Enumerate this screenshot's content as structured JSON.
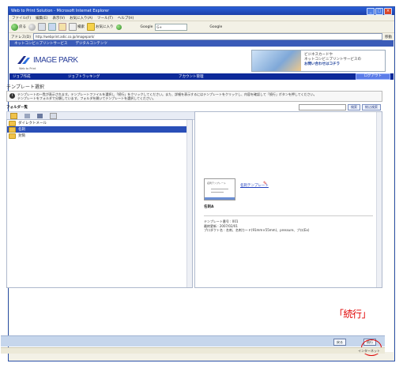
{
  "window": {
    "title": "Web to Print Solution - Microsoft Internet Explorer",
    "controls": [
      "_",
      "□",
      "×"
    ]
  },
  "menu": [
    "ファイル(F)",
    "編集(E)",
    "表示(V)",
    "お気に入り(A)",
    "ツール(T)",
    "ヘルプ(H)"
  ],
  "toolbar": {
    "back": "戻る",
    "search": "検索",
    "favorites": "お気に入り",
    "google": "Google",
    "search_placeholder": "G+",
    "extra": "Google"
  },
  "address": {
    "label": "アドレス(D)",
    "value": "http://webprint.adic.co.jp/imagepark/",
    "go": "移動"
  },
  "service_bar": [
    "ネットコンビニプリントサービス",
    "デジタルコンテンツ"
  ],
  "brand": {
    "name": "IMAGE PARK",
    "sub": "Web to Print"
  },
  "banner": {
    "line1": "ビジネスカードや",
    "line2": "ネットコンビニプリントサービスの",
    "line3": "お問い合わせはコチラ"
  },
  "nav": {
    "items": [
      "ジョブ作成",
      "ジョブトラッキング",
      "アカウント管理"
    ],
    "active": "ログアウト"
  },
  "page": {
    "title": "テンプレート選択",
    "info": "テンプレートの一覧が表示されます。テンプレートファイルを選択し「続行」をクリックしてください。また、詳細を表示するにはテンプレートをクリックし、内容を確認して「続行」ボタンを押してください。",
    "info2": "テンプレートをフォルダで分類しています。フォルダを開いてテンプレートを選択してください。"
  },
  "folder": {
    "label": "フォルダ一覧",
    "search_btn": "検索",
    "refine_btn": "絞込検索"
  },
  "tree": [
    {
      "label": "ダイレクトメール",
      "selected": false
    },
    {
      "label": "名刺",
      "selected": true
    },
    {
      "label": "封筒",
      "selected": false
    }
  ],
  "preview": {
    "template_link": "名刺テンプレート",
    "name": "名刺A",
    "meta1": "テンプレート番号 : 001",
    "meta2": "最終更新 : 2007/02/01",
    "meta3": "プロダクト名 : 名刺、名刺カード(91mm×55mm)、pressure、プロ(Ex)"
  },
  "callout": "「続行」",
  "bottom": {
    "back_btn": "戻る",
    "continue_btn": "続行"
  },
  "status": {
    "left": "",
    "zone": "インターネット"
  }
}
